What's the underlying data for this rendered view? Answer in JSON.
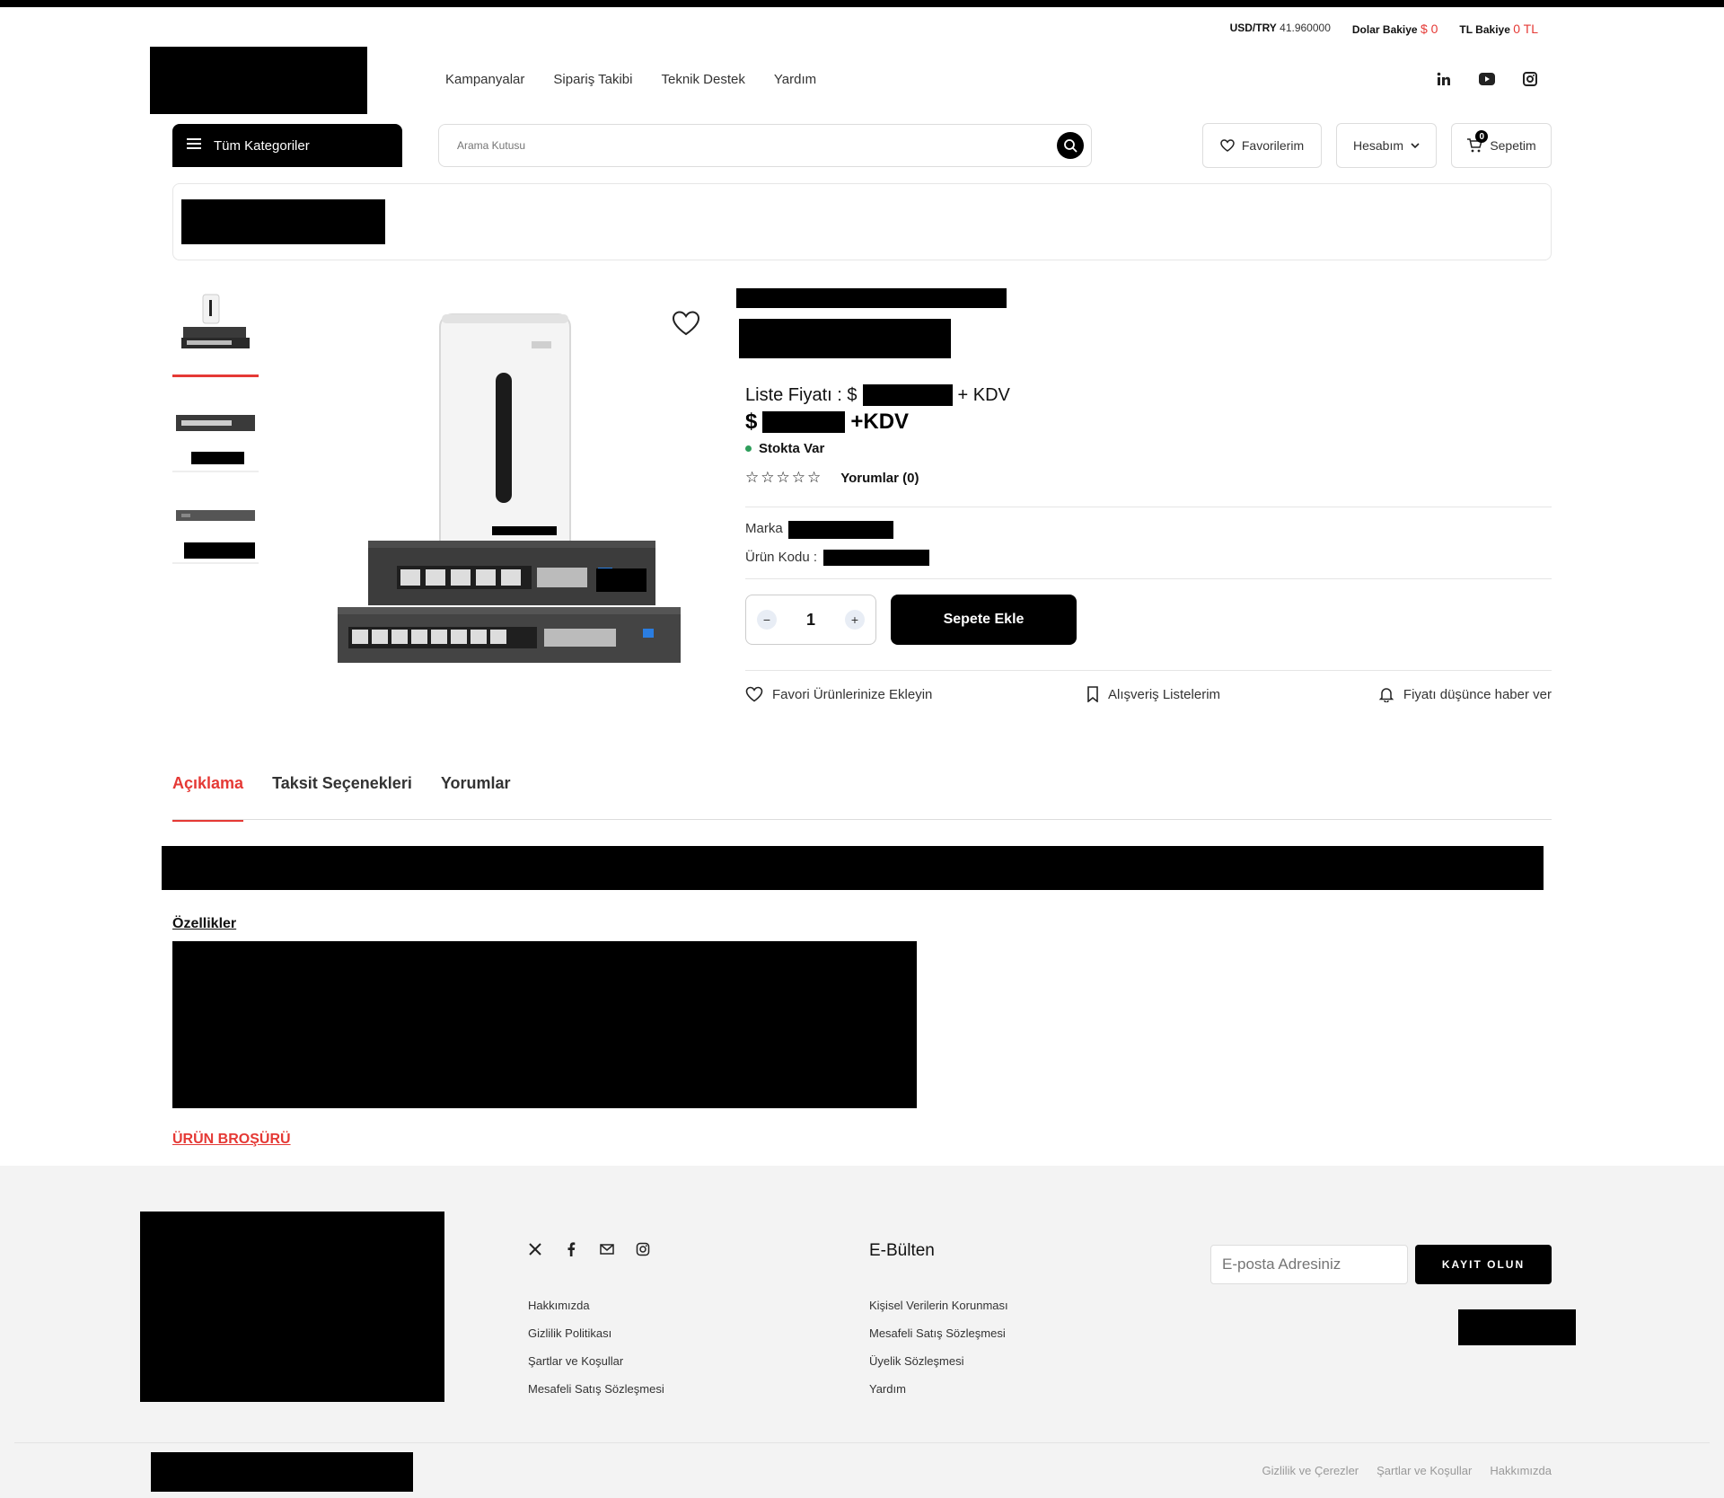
{
  "header": {
    "rates": {
      "usd_try_label": "USD/TRY",
      "usd_try_value": "41.960000",
      "dollar_balance_label": "Dolar Bakiye",
      "dollar_balance_value": "$ 0",
      "tl_balance_label": "TL Bakiye",
      "tl_balance_value": "0 TL"
    },
    "nav": [
      "Kampanyalar",
      "Sipariş Takibi",
      "Teknik Destek",
      "Yardım"
    ],
    "social_icons": [
      "linkedin-icon",
      "youtube-icon",
      "instagram-icon"
    ],
    "categories_label": "Tüm Kategoriler",
    "search_placeholder": "Arama Kutusu",
    "favorites_label": "Favorilerim",
    "account_label": "Hesabım",
    "cart_label": "Sepetim",
    "cart_count": "0"
  },
  "product": {
    "list_price_label": "Liste Fiyatı : $",
    "list_price_suffix": "+ KDV",
    "price_prefix": "$",
    "price_suffix": "+KDV",
    "stock_status": "Stokta Var",
    "stars": "☆☆☆☆☆",
    "reviews_label": "Yorumlar (0)",
    "brand_label": "Marka",
    "code_label": "Ürün Kodu :",
    "quantity": "1",
    "add_to_cart": "Sepete Ekle",
    "actions": {
      "favorite": "Favori Ürünlerinize Ekleyin",
      "shopping_lists": "Alışveriş Listelerim",
      "price_alert": "Fiyatı düşünce haber ver"
    }
  },
  "tabs": {
    "items": [
      "Açıklama",
      "Taksit Seçenekleri",
      "Yorumlar"
    ],
    "active": "Açıklama"
  },
  "description": {
    "features_title": "Özellikler",
    "brochure_link": "ÜRÜN BROŞÜRÜ"
  },
  "footer": {
    "social_icons": [
      "x-icon",
      "facebook-icon",
      "mail-icon",
      "instagram-icon"
    ],
    "links_col1": [
      "Hakkımızda",
      "Gizlilik Politikası",
      "Şartlar ve Koşullar",
      "Mesafeli Satış Sözleşmesi"
    ],
    "ebulten_title": "E-Bülten",
    "links_col2": [
      "Kişisel Verilerin Korunması",
      "Mesafeli Satış Sözleşmesi",
      "Üyelik Sözleşmesi",
      "Yardım"
    ],
    "email_placeholder": "E-posta Adresiniz",
    "subscribe_label": "KAYIT OLUN",
    "bottom_links": [
      "Gizlilik ve Çerezler",
      "Şartlar ve Koşullar",
      "Hakkımızda"
    ]
  },
  "colors": {
    "accent": "#e53935",
    "stock_green": "#2e9e5b",
    "footer_bg": "#f3f3f3"
  }
}
